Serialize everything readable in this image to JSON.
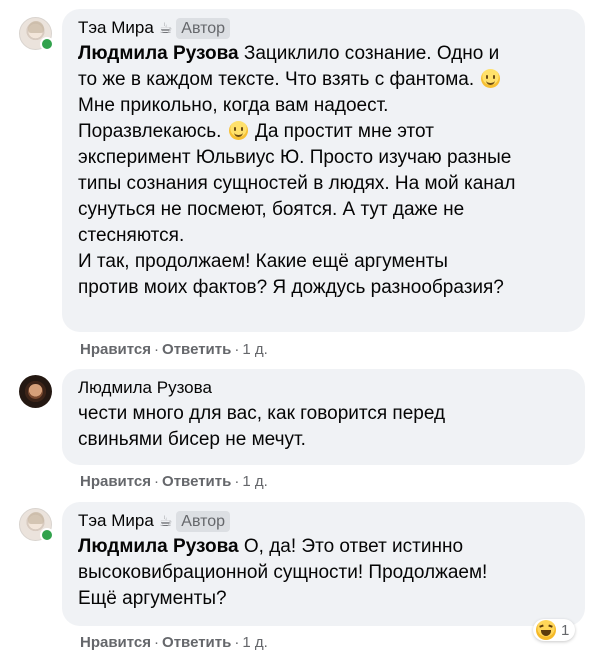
{
  "comments": [
    {
      "author": "Тэа Мира",
      "badge": "Автор",
      "mention": "Людмила Рузова",
      "lines": [
        " Зациклило сознание. Одно и",
        "то же в каждом тексте. Что взять с фантома.",
        "Мне прикольно, когда вам надоест.",
        "Поразвлекаюсь.",
        " Да простит мне этот",
        "эксперимент Юльвиус Ю. Просто изучаю разные",
        "типы сознания сущностей в людях. На мой канал",
        "сунуться не посмеют, боятся. А тут даже не",
        "стесняются.",
        "И так, продолжаем! Какие ещё аргументы",
        "против моих фактов? Я дождусь разнообразия?"
      ],
      "like": "Нравится",
      "reply": "Ответить",
      "time": "1 д."
    },
    {
      "author": "Людмила Рузова",
      "lines": [
        "чести много для вас, как говорится перед",
        "свиньями бисер не мечут."
      ],
      "like": "Нравится",
      "reply": "Ответить",
      "time": "1 д."
    },
    {
      "author": "Тэа Мира",
      "badge": "Автор",
      "mention": "Людмила Рузова",
      "lines": [
        " О, да! Это ответ истинно",
        "высоковибрационной сущности! Продолжаем!",
        "Ещё аргументы?"
      ],
      "like": "Нравится",
      "reply": "Ответить",
      "time": "1 д.",
      "reaction_count": "1",
      "reaction_icon": "haha-icon"
    }
  ],
  "separator": "·",
  "colors": {
    "bubble": "#f0f2f5",
    "meta_text": "#65676b",
    "online": "#31a24c"
  }
}
